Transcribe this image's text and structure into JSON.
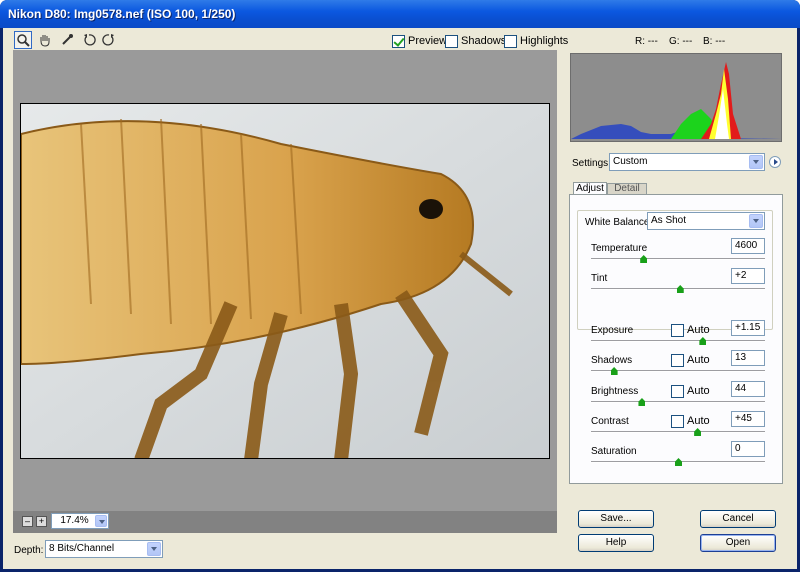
{
  "window": {
    "title": "Nikon D80:  Img0578.nef  (ISO 100, 1/250)"
  },
  "toolbar": {
    "tools": [
      "zoom-icon",
      "hand-icon",
      "eyedropper-icon",
      "rotate-left-icon",
      "rotate-right-icon"
    ],
    "preview": {
      "label": "Preview",
      "checked": true
    },
    "shadows": {
      "label": "Shadows",
      "checked": false
    },
    "highlights": {
      "label": "Highlights",
      "checked": false
    }
  },
  "readout": {
    "r": "R: ---",
    "g": "G: ---",
    "b": "B: ---"
  },
  "zoom": {
    "value": "17.4%",
    "minus": "–",
    "plus": "+"
  },
  "depth": {
    "label": "Depth:",
    "value": "8 Bits/Channel"
  },
  "settings": {
    "label": "Settings:",
    "value": "Custom"
  },
  "tabs": {
    "adjust": "Adjust",
    "detail": "Detail"
  },
  "white_balance": {
    "label": "White Balance:",
    "value": "As Shot"
  },
  "controls": {
    "temperature": {
      "label": "Temperature",
      "value": "4600",
      "level": 0.3
    },
    "tint": {
      "label": "Tint",
      "value": "+2",
      "level": 0.51
    },
    "exposure": {
      "label": "Exposure",
      "value": "+1.15",
      "auto": "Auto",
      "level": 0.64
    },
    "shadows": {
      "label": "Shadows",
      "value": "13",
      "auto": "Auto",
      "level": 0.13
    },
    "brightness": {
      "label": "Brightness",
      "value": "44",
      "auto": "Auto",
      "level": 0.29
    },
    "contrast": {
      "label": "Contrast",
      "value": "+45",
      "auto": "Auto",
      "level": 0.61
    },
    "saturation": {
      "label": "Saturation",
      "value": "0",
      "level": 0.5
    }
  },
  "buttons": {
    "save": "Save...",
    "cancel": "Cancel",
    "help": "Help",
    "open": "Open"
  },
  "colors": {
    "accent": "#0a246a",
    "knob": "#19a019"
  }
}
